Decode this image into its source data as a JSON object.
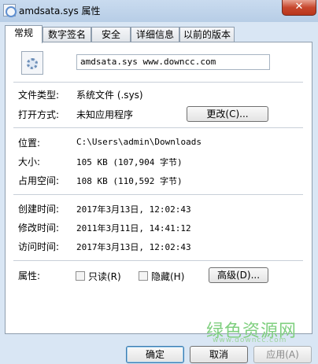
{
  "window": {
    "title": "amdsata.sys 属性",
    "close_label": "✕"
  },
  "tabs": [
    {
      "label": "常规",
      "active": true
    },
    {
      "label": "数字签名"
    },
    {
      "label": "安全"
    },
    {
      "label": "详细信息"
    },
    {
      "label": "以前的版本"
    }
  ],
  "general": {
    "file_name": "amdsata.sys www.downcc.com",
    "file_type_label": "文件类型:",
    "file_type_value": "系统文件 (.sys)",
    "open_with_label": "打开方式:",
    "open_with_value": "未知应用程序",
    "change_button": "更改(C)...",
    "location_label": "位置:",
    "location_value": "C:\\Users\\admin\\Downloads",
    "size_label": "大小:",
    "size_value": "105 KB (107,904 字节)",
    "size_on_disk_label": "占用空间:",
    "size_on_disk_value": "108 KB (110,592 字节)",
    "created_label": "创建时间:",
    "created_value": "2017年3月13日, 12:02:43",
    "modified_label": "修改时间:",
    "modified_value": "2011年3月11日, 14:41:12",
    "accessed_label": "访问时间:",
    "accessed_value": "2017年3月13日, 12:02:43",
    "attributes_label": "属性:",
    "readonly_label": "只读(R)",
    "hidden_label": "隐藏(H)",
    "advanced_button": "高级(D)..."
  },
  "watermark": {
    "text": "绿色资源网",
    "small": "www.downcc.com"
  },
  "footer": {
    "ok": "确定",
    "cancel": "取消",
    "apply": "应用(A)"
  }
}
